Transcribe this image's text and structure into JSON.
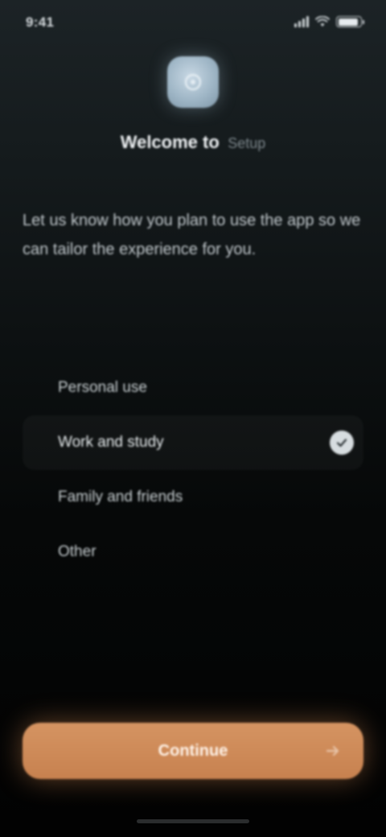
{
  "status_bar": {
    "time": "9:41",
    "battery_level": 0.9
  },
  "app": {
    "icon": "app-logo-icon",
    "title": "Welcome to",
    "title_suffix": "Setup"
  },
  "description": "Let us know how you plan to use the app so we can tailor the experience for you.",
  "options": [
    {
      "label": "Personal use",
      "selected": false
    },
    {
      "label": "Work and study",
      "selected": true
    },
    {
      "label": "Family and friends",
      "selected": false
    },
    {
      "label": "Other",
      "selected": false
    }
  ],
  "primary_button": {
    "label": "Continue",
    "icon": "arrow-right-icon"
  },
  "colors": {
    "accent": "#cf8a57",
    "background": "#0d1112",
    "check": "#d7dde0"
  }
}
